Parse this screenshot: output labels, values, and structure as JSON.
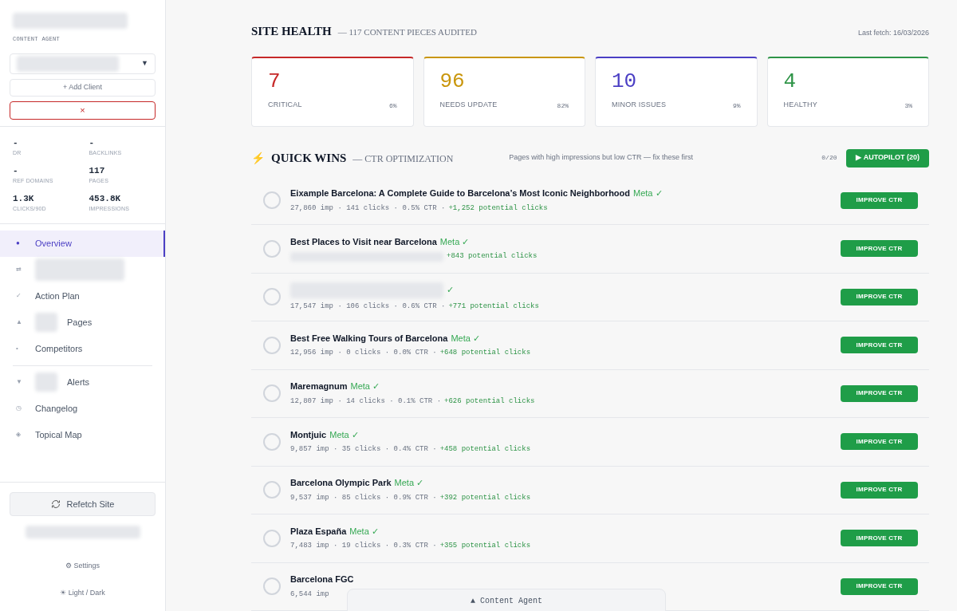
{
  "sidebar": {
    "brand_blurred": true,
    "subtitle": "CONTENT AGENT",
    "client_select": {
      "blurred": true,
      "caret": "▼"
    },
    "add_client": "+ Add Client",
    "remove_client": "×",
    "stats": [
      {
        "value": "-",
        "label": "DR"
      },
      {
        "value": "-",
        "label": "BACKLINKS"
      },
      {
        "value": "-",
        "label": "REF DOMAINS"
      },
      {
        "value": "117",
        "label": "PAGES"
      },
      {
        "value": "1.3K",
        "label": "CLICKS/90D"
      },
      {
        "value": "453.8K",
        "label": "IMPRESSIONS"
      }
    ],
    "nav": [
      {
        "icon": "●",
        "label": "Overview",
        "label_blurred": false,
        "prefix_blurred": false,
        "selected": true
      },
      {
        "icon": "⇄",
        "label_blurred": true,
        "prefix_blurred": false,
        "selected": false
      },
      {
        "icon": "✓",
        "label": "Action Plan",
        "label_blurred": false,
        "prefix_blurred": false,
        "selected": false
      },
      {
        "icon": "▲",
        "label": "Pages",
        "label_blurred": false,
        "prefix_blurred": true,
        "selected": false
      },
      {
        "icon": "•",
        "label": "Competitors",
        "label_blurred": false,
        "prefix_blurred": false,
        "selected": false
      }
    ],
    "nav_secondary": [
      {
        "icon": "▼",
        "label": "Alerts",
        "label_blurred": false,
        "prefix_blurred": true,
        "selected": false
      },
      {
        "icon": "◷",
        "label": "Changelog",
        "label_blurred": false,
        "prefix_blurred": false,
        "selected": false
      },
      {
        "icon": "◈",
        "label": "Topical Map",
        "label_blurred": false,
        "prefix_blurred": false,
        "selected": false
      }
    ],
    "refetch": "Refetch Site",
    "settings": "⚙ Settings",
    "theme_toggle": "☀ Light / Dark"
  },
  "site_health": {
    "title": "SITE HEALTH",
    "subtitle": "— 117 CONTENT PIECES AUDITED",
    "last_fetch": "Last fetch: 16/03/2026",
    "cards": [
      {
        "value": "7",
        "label": "CRITICAL",
        "percent": "6%",
        "color": "#c62828"
      },
      {
        "value": "96",
        "label": "NEEDS UPDATE",
        "percent": "82%",
        "color": "#c9960c"
      },
      {
        "value": "10",
        "label": "MINOR ISSUES",
        "percent": "9%",
        "color": "#4b3fc4"
      },
      {
        "value": "4",
        "label": "HEALTHY",
        "percent": "3%",
        "color": "#2e9447"
      }
    ]
  },
  "quick_wins": {
    "icon": "⚡",
    "title": "QUICK WINS",
    "subtitle": "— CTR OPTIMIZATION",
    "description": "Pages with high impressions but low CTR — fix these first",
    "progress": "0/20",
    "autopilot": "▶ AUTOPILOT (20)",
    "rows": [
      {
        "checked": false,
        "title": "Eixample Barcelona: A Complete Guide to Barcelona’s Most Iconic Neighborhood",
        "title_blurred": false,
        "tag": "Meta ✓",
        "stats": "27,860 imp · 141 clicks · 0.5% CTR ·",
        "stats_blurred": false,
        "potential": "+1,252 potential clicks",
        "action": "IMPROVE CTR"
      },
      {
        "checked": false,
        "title": "Best Places to Visit near Barcelona",
        "title_blurred": false,
        "tag": "Meta ✓",
        "stats_blurred": true,
        "potential": "+843 potential clicks",
        "action": "IMPROVE CTR"
      },
      {
        "checked": false,
        "title_blurred": true,
        "tag": "✓",
        "stats": "17,547 imp · 106 clicks · 0.6% CTR ·",
        "stats_blurred": false,
        "potential": "+771 potential clicks",
        "action": "IMPROVE CTR"
      },
      {
        "checked": false,
        "title": "Best Free Walking Tours of Barcelona",
        "title_blurred": false,
        "tag": "Meta ✓",
        "stats": "12,956 imp · 0 clicks · 0.0% CTR ·",
        "stats_blurred": false,
        "potential": "+648 potential clicks",
        "action": "IMPROVE CTR"
      },
      {
        "checked": false,
        "title": "Maremagnum",
        "title_blurred": false,
        "tag": "Meta ✓",
        "stats": "12,807 imp · 14 clicks · 0.1% CTR ·",
        "stats_blurred": false,
        "potential": "+626 potential clicks",
        "action": "IMPROVE CTR"
      },
      {
        "checked": false,
        "title": "Montjuic",
        "title_blurred": false,
        "tag": "Meta ✓",
        "stats": "9,857 imp · 35 clicks · 0.4% CTR ·",
        "stats_blurred": false,
        "potential": "+458 potential clicks",
        "action": "IMPROVE CTR"
      },
      {
        "checked": false,
        "title": "Barcelona Olympic Park",
        "title_blurred": false,
        "tag": "Meta ✓",
        "stats": "9,537 imp · 85 clicks · 0.9% CTR ·",
        "stats_blurred": false,
        "potential": "+392 potential clicks",
        "action": "IMPROVE CTR"
      },
      {
        "checked": false,
        "title": "Plaza España",
        "title_blurred": false,
        "tag": "Meta ✓",
        "stats": "7,483 imp · 19 clicks · 0.3% CTR ·",
        "stats_blurred": false,
        "potential": "+355 potential clicks",
        "action": "IMPROVE CTR"
      },
      {
        "checked": false,
        "title": "Barcelona FGC",
        "title_blurred": false,
        "stats": "6,544 imp",
        "stats_blurred": false,
        "action": "IMPROVE CTR"
      }
    ]
  },
  "agent_bar": {
    "label": "▲ Content Agent"
  }
}
